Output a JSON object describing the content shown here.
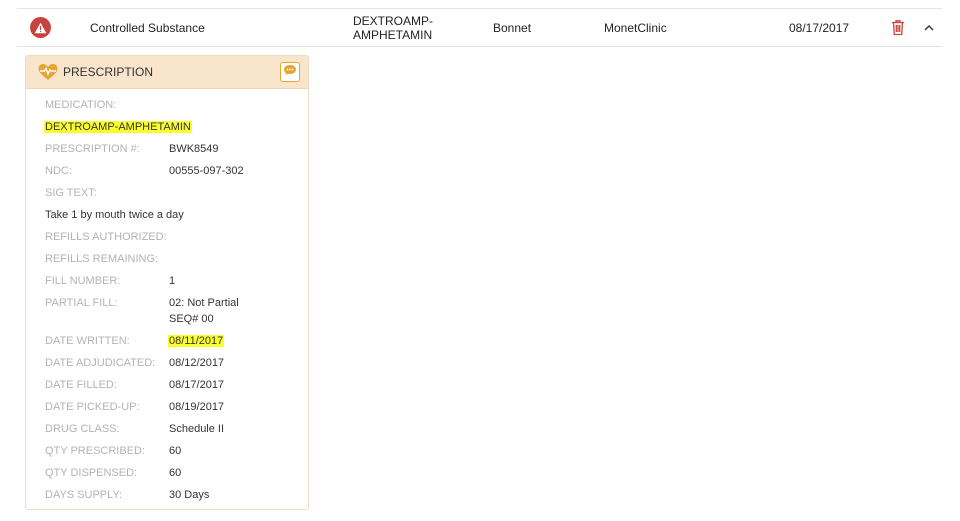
{
  "row": {
    "type": "Controlled Substance",
    "medication": "DEXTROAMP-\nAMPHETAMIN",
    "medication_line1": "DEXTROAMP-",
    "medication_line2": "AMPHETAMIN",
    "prescriber": "Bonnet",
    "pharmacy": "MonetClinic",
    "date": "08/17/2017"
  },
  "colors": {
    "alert": "#c9433e",
    "header_bg": "#f8e5cb",
    "accent": "#e6a533",
    "highlight": "#fbff2b",
    "label": "#b3b3b3"
  },
  "icons": {
    "alert": "alert-triangle-icon",
    "delete": "trash-icon",
    "collapse": "chevron-up-icon",
    "card": "heart-pulse-icon",
    "comment": "comment-icon"
  },
  "card": {
    "title": "PRESCRIPTION",
    "medication_label": "MEDICATION:",
    "medication_value": "DEXTROAMP-AMPHETAMIN",
    "fields": {
      "rx_number": {
        "label": "PRESCRIPTION #:",
        "value": "BWK8549"
      },
      "ndc": {
        "label": "NDC:",
        "value": "00555-097-302"
      },
      "sig_text_label": "SIG TEXT:",
      "sig_text_value": "Take 1 by mouth twice a day",
      "refills_authorized": {
        "label": "REFILLS AUTHORIZED:",
        "value": ""
      },
      "refills_remaining": {
        "label": "REFILLS REMAINING:",
        "value": ""
      },
      "fill_number": {
        "label": "FILL NUMBER:",
        "value": "1"
      },
      "partial_fill": {
        "label": "PARTIAL FILL:",
        "value_line1": "02: Not Partial",
        "value_line2": "SEQ# 00"
      },
      "date_written": {
        "label": "DATE WRITTEN:",
        "value": "08/11/2017"
      },
      "date_adjudicated": {
        "label": "DATE ADJUDICATED:",
        "value": "08/12/2017"
      },
      "date_filled": {
        "label": "DATE FILLED:",
        "value": "08/17/2017"
      },
      "date_picked_up": {
        "label": "DATE PICKED-UP:",
        "value": "08/19/2017"
      },
      "drug_class": {
        "label": "DRUG CLASS:",
        "value": "Schedule II"
      },
      "qty_prescribed": {
        "label": "QTY PRESCRIBED:",
        "value": "60"
      },
      "qty_dispensed": {
        "label": "QTY DISPENSED:",
        "value": "60"
      },
      "days_supply": {
        "label": "DAYS SUPPLY:",
        "value": "30 Days"
      }
    }
  }
}
